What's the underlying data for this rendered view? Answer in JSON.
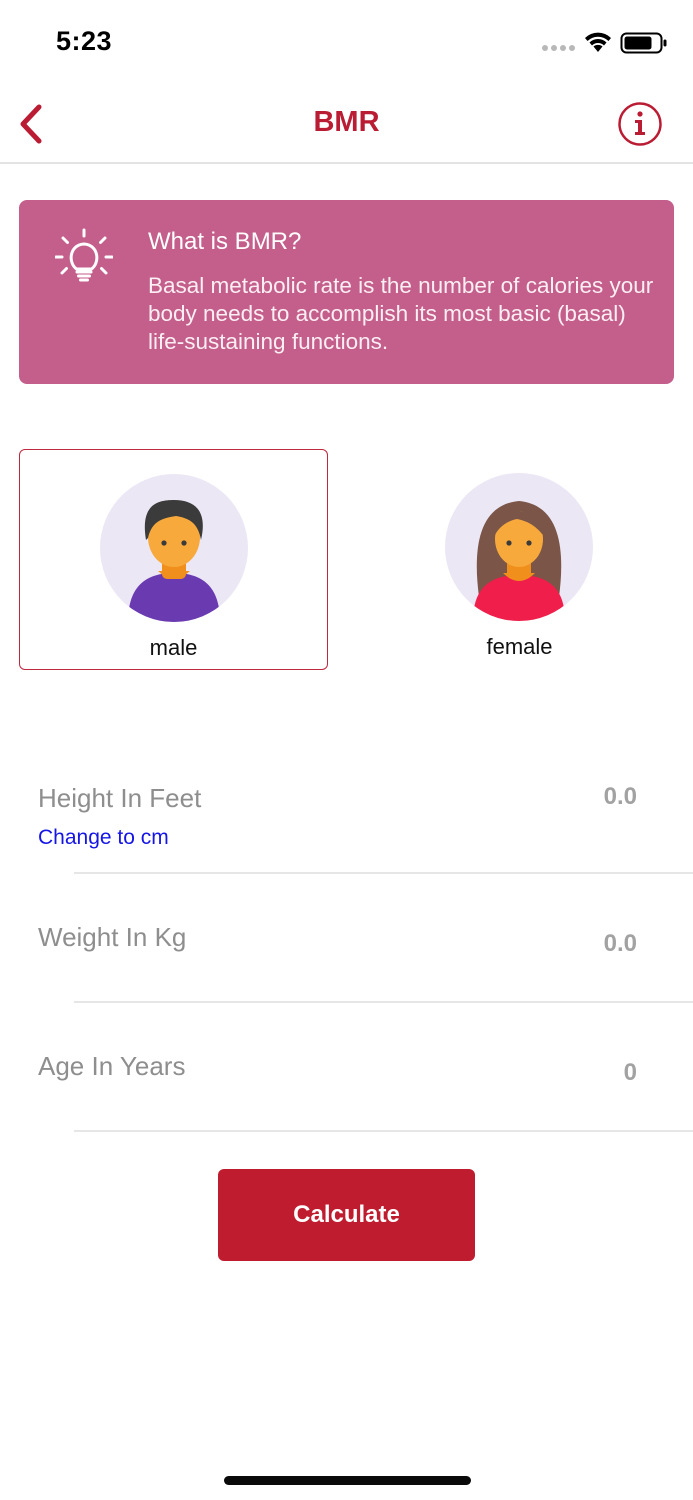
{
  "status": {
    "time": "5:23"
  },
  "nav": {
    "title": "BMR",
    "back_icon": "chevron-left-icon",
    "info_icon": "info-circle-icon"
  },
  "info_card": {
    "icon": "lightbulb-icon",
    "title": "What is BMR?",
    "description": "Basal metabolic rate is the number of calories your body needs to accomplish its most basic (basal) life-sustaining functions."
  },
  "gender": {
    "selected": "male",
    "options": [
      {
        "label": "male"
      },
      {
        "label": "female"
      }
    ]
  },
  "fields": {
    "height": {
      "label": "Height In Feet",
      "value": "0.0",
      "link": "Change to cm"
    },
    "weight": {
      "label": "Weight In Kg",
      "value": "0.0"
    },
    "age": {
      "label": "Age In Years",
      "value": "0"
    }
  },
  "calculate_label": "Calculate",
  "colors": {
    "accent": "#bf1d2f",
    "card": "#c45e8b",
    "link": "#1515e6"
  }
}
